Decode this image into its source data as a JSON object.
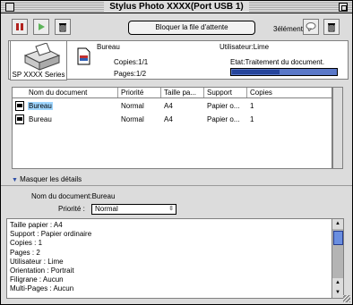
{
  "window": {
    "title": "Stylus Photo XXXX(Port USB 1)"
  },
  "toolbar": {
    "pause_icon": "pause-icon",
    "resume_icon": "play-icon",
    "delete_icon": "trash-icon",
    "hold_queue_label": "Bloquer la file d'attente",
    "count_label": "3éléments",
    "balloon_icon": "balloon-help-icon",
    "trash_icon": "trash-icon"
  },
  "printer": {
    "model": "SP XXXX Series"
  },
  "job": {
    "name": "Bureau",
    "copies": "Copies:1/1",
    "pages": "Pages:1/2",
    "user": "Utilisateur:Lime",
    "status": "Etat:Traitement du document.",
    "progress": 0.45
  },
  "table": {
    "columns": [
      "Nom du document",
      "Priorité",
      "Taille pa...",
      "Support",
      "Copies"
    ],
    "rows": [
      [
        "Bureau",
        "Normal",
        "A4",
        "Papier o...",
        "1"
      ],
      [
        "Bureau",
        "Normal",
        "A4",
        "Papier o...",
        "1"
      ]
    ]
  },
  "details": {
    "toggle_label": "Masquer les détails",
    "doc_name_label": "Nom du document:Bureau",
    "priority_label": "Priorité :",
    "priority_value": "Normal",
    "lines": [
      "Taille papier : A4",
      "Support : Papier ordinaire",
      "Copies : 1",
      "Pages : 2",
      "Utilisateur : Lime",
      "Orientation : Portrait",
      "Filigrane : Aucun",
      "Multi-Pages : Aucun"
    ]
  }
}
